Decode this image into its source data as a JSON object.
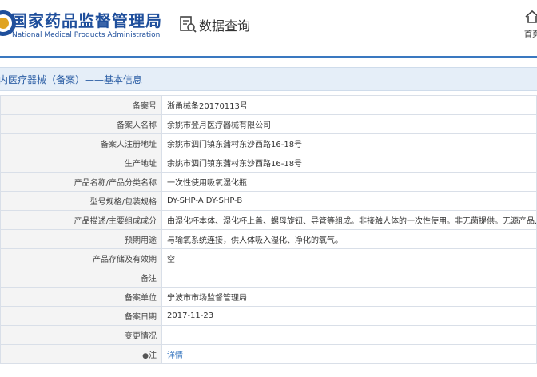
{
  "header": {
    "agency_cn": "国家药品监督管理局",
    "agency_en": "National Medical Products Administration",
    "page_title": "数据查询",
    "home_label": "首页",
    "accent_color": "#1f4f9c",
    "logo_icon": "nmpa-emblem",
    "query_icon": "document-search-icon",
    "home_icon": "home-icon"
  },
  "section": {
    "title": "内医疗器械（备案）——基本信息"
  },
  "table": {
    "rows": [
      {
        "label": "备案号",
        "value": "浙甬械备20170113号"
      },
      {
        "label": "备案人名称",
        "value": "余姚市登月医疗器械有限公司"
      },
      {
        "label": "备案人注册地址",
        "value": "余姚市泗门镇东蒲村东沙西路16-18号"
      },
      {
        "label": "生产地址",
        "value": "余姚市泗门镇东蒲村东沙西路16-18号"
      },
      {
        "label": "产品名称/产品分类名称",
        "value": "一次性使用吸氧湿化瓶"
      },
      {
        "label": "型号规格/包装规格",
        "value": "DY-SHP-A DY-SHP-B"
      },
      {
        "label": "产品描述/主要组成成分",
        "value": "由湿化杯本体、湿化杯上盖、螺母旋钮、导管等组成。非接触人体的一次性使用。非无菌提供。无源产品."
      },
      {
        "label": "预期用途",
        "value": "与输氧系统连接，供人体吸入湿化、净化的氧气。"
      },
      {
        "label": "产品存储及有效期",
        "value": "空"
      },
      {
        "label": "备注",
        "value": ""
      },
      {
        "label": "备案单位",
        "value": "宁波市市场监督管理局"
      },
      {
        "label": "备案日期",
        "value": "2017-11-23"
      },
      {
        "label": "变更情况",
        "value": ""
      },
      {
        "label": "注",
        "value": "详情"
      }
    ],
    "note_pin": "●"
  }
}
